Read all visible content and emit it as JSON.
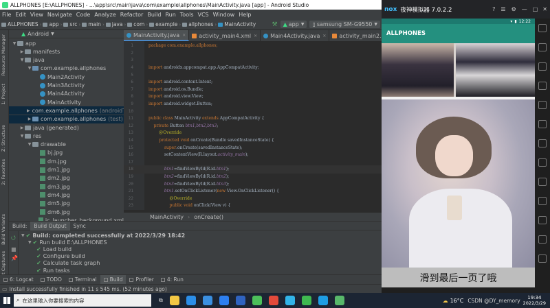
{
  "title_bar": {
    "text": "ALLPHONES [E:\\ALLPHONES] - ...\\app\\src\\main\\java\\com\\example\\allphones\\MainActivity.java [app] - Android Studio"
  },
  "menu": [
    "File",
    "Edit",
    "View",
    "Navigate",
    "Code",
    "Analyze",
    "Refactor",
    "Build",
    "Run",
    "Tools",
    "VCS",
    "Window",
    "Help"
  ],
  "breadcrumbs": [
    "ALLPHONES",
    "app",
    "src",
    "main",
    "java",
    "com",
    "example",
    "allphones",
    "MainActivity"
  ],
  "run_config": "app",
  "device": "samsung SM-G9550",
  "project_view": "Android",
  "tree": [
    {
      "label": "app",
      "indent": 0,
      "icon": "folder",
      "open": true
    },
    {
      "label": "manifests",
      "indent": 1,
      "icon": "folder",
      "open": false
    },
    {
      "label": "java",
      "indent": 1,
      "icon": "folder",
      "open": true
    },
    {
      "label": "com.example.allphones",
      "indent": 2,
      "icon": "package",
      "open": true
    },
    {
      "label": "Main2Activity",
      "indent": 3,
      "icon": "class"
    },
    {
      "label": "Main3Activity",
      "indent": 3,
      "icon": "class"
    },
    {
      "label": "Main4Activity",
      "indent": 3,
      "icon": "class"
    },
    {
      "label": "MainActivity",
      "indent": 3,
      "icon": "class"
    },
    {
      "label": "com.example.allphones",
      "suffix": "(androidTest)",
      "indent": 2,
      "icon": "package",
      "open": false,
      "sel": true
    },
    {
      "label": "com.example.allphones",
      "suffix": "(test)",
      "indent": 2,
      "icon": "package",
      "open": false,
      "sel": true
    },
    {
      "label": "java (generated)",
      "indent": 1,
      "icon": "folder",
      "open": false
    },
    {
      "label": "res",
      "indent": 1,
      "icon": "folder",
      "open": true
    },
    {
      "label": "drawable",
      "indent": 2,
      "icon": "folder",
      "open": true
    },
    {
      "label": "bj.jpg",
      "indent": 3,
      "icon": "image"
    },
    {
      "label": "dm.jpg",
      "indent": 3,
      "icon": "image"
    },
    {
      "label": "dm1.jpg",
      "indent": 3,
      "icon": "image"
    },
    {
      "label": "dm2.jpg",
      "indent": 3,
      "icon": "image"
    },
    {
      "label": "dm3.jpg",
      "indent": 3,
      "icon": "image"
    },
    {
      "label": "dm4.jpg",
      "indent": 3,
      "icon": "image"
    },
    {
      "label": "dm5.jpg",
      "indent": 3,
      "icon": "image"
    },
    {
      "label": "dm6.jpg",
      "indent": 3,
      "icon": "image"
    },
    {
      "label": "ic_launcher_background.xml",
      "indent": 3,
      "icon": "image"
    }
  ],
  "editor_tabs": [
    {
      "label": "MainActivity.java",
      "active": true
    },
    {
      "label": "activity_main4.xml",
      "active": false
    },
    {
      "label": "Main4Activity.java",
      "active": false
    },
    {
      "label": "activity_main2.xml",
      "active": false
    }
  ],
  "code": [
    {
      "n": "1",
      "t": [
        {
          "s": "package com.example.allphones;",
          "c": "kw"
        }
      ]
    },
    {
      "n": "2",
      "t": []
    },
    {
      "n": "3",
      "t": []
    },
    {
      "n": "4",
      "t": [
        {
          "s": "import",
          "c": "kw"
        },
        {
          "s": " androidx.appcompat.app.AppCompatActivity;"
        }
      ]
    },
    {
      "n": "5",
      "t": []
    },
    {
      "n": "6",
      "t": [
        {
          "s": "import",
          "c": "kw"
        },
        {
          "s": " android.content.Intent;"
        }
      ]
    },
    {
      "n": "7",
      "t": [
        {
          "s": "import",
          "c": "kw"
        },
        {
          "s": " android.os.Bundle;"
        }
      ]
    },
    {
      "n": "8",
      "t": [
        {
          "s": "import",
          "c": "kw"
        },
        {
          "s": " android.view.View;"
        }
      ]
    },
    {
      "n": "9",
      "t": [
        {
          "s": "import",
          "c": "kw"
        },
        {
          "s": " android.widget.Button;"
        }
      ]
    },
    {
      "n": "10",
      "t": []
    },
    {
      "n": "11",
      "t": [
        {
          "s": "public class",
          "c": "kw"
        },
        {
          "s": " MainActivity "
        },
        {
          "s": "extends",
          "c": "kw"
        },
        {
          "s": " AppCompatActivity {"
        }
      ]
    },
    {
      "n": "12",
      "t": [
        {
          "s": "    private",
          "c": "kw"
        },
        {
          "s": " Button "
        },
        {
          "s": "btn1,btn2,btn3",
          "c": "it"
        },
        {
          "s": ";"
        }
      ]
    },
    {
      "n": "13",
      "t": [
        {
          "s": "        @Override",
          "c": "an"
        }
      ]
    },
    {
      "n": "14",
      "t": [
        {
          "s": "        protected void",
          "c": "kw"
        },
        {
          "s": " onCreate(Bundle savedInstanceState) {"
        }
      ]
    },
    {
      "n": "15",
      "t": [
        {
          "s": "            super",
          "c": "kw"
        },
        {
          "s": ".onCreate(savedInstanceState);"
        }
      ]
    },
    {
      "n": "16",
      "t": [
        {
          "s": "            setContentView(R.layout."
        },
        {
          "s": "activity_main",
          "c": "it"
        },
        {
          "s": ");"
        }
      ]
    },
    {
      "n": "17",
      "t": []
    },
    {
      "n": "18",
      "t": [
        {
          "s": "            btn1",
          "c": "it"
        },
        {
          "s": "=findViewById(R.id."
        },
        {
          "s": "btn1",
          "c": "it"
        },
        {
          "s": ");"
        }
      ]
    },
    {
      "n": "19",
      "t": [
        {
          "s": "            btn2",
          "c": "it"
        },
        {
          "s": "=findViewById(R.id."
        },
        {
          "s": "btn2",
          "c": "it"
        },
        {
          "s": ");"
        }
      ]
    },
    {
      "n": "20",
      "t": [
        {
          "s": "            btn3",
          "c": "it"
        },
        {
          "s": "=findViewById(R.id."
        },
        {
          "s": "btn3",
          "c": "it"
        },
        {
          "s": ");"
        }
      ]
    },
    {
      "n": "21",
      "t": [
        {
          "s": "            btn1",
          "c": "it"
        },
        {
          "s": ".setOnClickListener("
        },
        {
          "s": "new",
          "c": "kw"
        },
        {
          "s": " View.OnClickListener() {"
        }
      ]
    },
    {
      "n": "22",
      "t": [
        {
          "s": "                @Override",
          "c": "an"
        }
      ]
    },
    {
      "n": "23",
      "t": [
        {
          "s": "                public void",
          "c": "kw"
        },
        {
          "s": " onClick(View v) {"
        }
      ]
    }
  ],
  "editor_breadcrumb": [
    "MainActivity",
    "onCreate()"
  ],
  "build_tabs": [
    "Build:",
    "Build Output",
    "Sync"
  ],
  "build_lines": [
    {
      "text": "Build: completed successfully at 2022/3/29 18:42",
      "indent": 0,
      "bold": true
    },
    {
      "text": "Run build E:\\ALLPHONES",
      "indent": 1
    },
    {
      "text": "Load build",
      "indent": 2
    },
    {
      "text": "Configure build",
      "indent": 2
    },
    {
      "text": "Calculate task graph",
      "indent": 2
    },
    {
      "text": "Run tasks",
      "indent": 2
    }
  ],
  "bottom_tabs": [
    "6: Logcat",
    "TODO",
    "Terminal",
    "Build",
    "Profiler",
    "4: Run"
  ],
  "status": "Install successfully finished in 11 s 545 ms. (52 minutes ago)",
  "left_vtabs": [
    "Resource Manager",
    "1: Project",
    "Z: Structure",
    "2: Favorites",
    "Build Variants",
    "Layout Captures"
  ],
  "emulator": {
    "brand": "nox",
    "title": "夜神模拟器 7.0.2.2",
    "time": "12:22",
    "app_bar_title": "ALLPHONES",
    "caption": "滑到最后一页了哦"
  },
  "taskbar": {
    "search_placeholder": "在这里输入你要搜索的内容",
    "weather": "16°C",
    "clock_time": "19:34",
    "clock_date": "2022/3/29",
    "watermark": "CSDN @DY_memory"
  }
}
